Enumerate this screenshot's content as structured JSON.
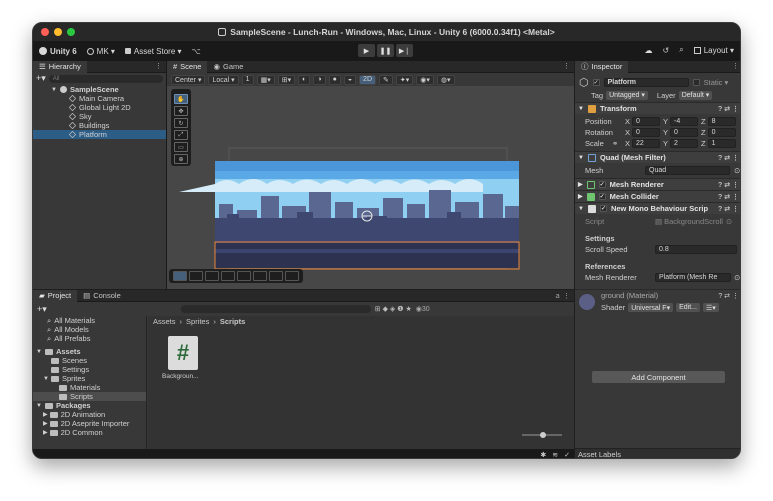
{
  "titlebar": {
    "title": "SampleScene - Lunch-Run - Windows, Mac, Linux - Unity 6 (6000.0.34f1) <Metal>"
  },
  "toolbar": {
    "unity_label": "Unity 6",
    "account_label": "MK ▾",
    "asset_store_label": "Asset Store ▾",
    "layout_label": "Layout ▾"
  },
  "hierarchy": {
    "tab_label": "Hierarchy",
    "search_placeholder": "All",
    "items": [
      {
        "label": "SampleScene"
      },
      {
        "label": "Main Camera"
      },
      {
        "label": "Global Light 2D"
      },
      {
        "label": "Sky"
      },
      {
        "label": "Buildings"
      },
      {
        "label": "Platform"
      }
    ]
  },
  "scene": {
    "tabs": [
      {
        "label": "Scene"
      },
      {
        "label": "Game"
      }
    ],
    "pivot_label": "Center ▾",
    "space_label": "Local ▾",
    "grid_value": "1",
    "mode_2d_label": "2D"
  },
  "inspector": {
    "tab_label": "Inspector",
    "object_name": "Platform",
    "static_label": "Static ▾",
    "tag_label": "Tag",
    "tag_value": "Untagged ▾",
    "layer_label": "Layer",
    "layer_value": "Default ▾",
    "transform": {
      "title": "Transform",
      "position_label": "Position",
      "position": [
        "0",
        "-4",
        "8"
      ],
      "rotation_label": "Rotation",
      "rotation": [
        "0",
        "0",
        "0"
      ],
      "scale_label": "Scale",
      "scale": [
        "22",
        "2",
        "1"
      ],
      "axes": [
        "X",
        "Y",
        "Z"
      ]
    },
    "mesh_filter": {
      "title": "Quad (Mesh Filter)",
      "mesh_label": "Mesh",
      "mesh_value": "Quad"
    },
    "mesh_renderer": {
      "title": "Mesh Renderer"
    },
    "mesh_collider": {
      "title": "Mesh Collider"
    },
    "mono": {
      "title": "New Mono Behaviour Scrip",
      "script_label": "Script",
      "script_value": "BackgroundScroll",
      "settings_heading": "Settings",
      "scroll_speed_label": "Scroll Speed",
      "scroll_speed_value": "0.8",
      "references_heading": "References",
      "mesh_renderer_label": "Mesh Renderer",
      "mesh_renderer_value": "Platform (Mesh Re"
    },
    "material": {
      "name": "ground (Material)",
      "shader_label": "Shader",
      "shader_value": "Universal F▾",
      "edit_label": "Edit..."
    },
    "add_component_label": "Add Component",
    "asset_labels": "Asset Labels"
  },
  "project": {
    "tabs": [
      {
        "label": "Project"
      },
      {
        "label": "Console"
      }
    ],
    "search_count": "30",
    "left_items": [
      {
        "label": "All Materials",
        "kind": "search"
      },
      {
        "label": "All Models",
        "kind": "search"
      },
      {
        "label": "All Prefabs",
        "kind": "search"
      },
      {
        "label": "Assets",
        "kind": "root"
      },
      {
        "label": "Scenes",
        "kind": "folder"
      },
      {
        "label": "Settings",
        "kind": "folder"
      },
      {
        "label": "Sprites",
        "kind": "folder"
      },
      {
        "label": "Materials",
        "kind": "sub"
      },
      {
        "label": "Scripts",
        "kind": "sub"
      },
      {
        "label": "Packages",
        "kind": "root"
      },
      {
        "label": "2D Animation",
        "kind": "folder"
      },
      {
        "label": "2D Aseprite Importer",
        "kind": "folder"
      },
      {
        "label": "2D Common",
        "kind": "folder"
      }
    ],
    "breadcrumb": [
      "Assets",
      "Sprites",
      "Scripts"
    ],
    "file_label": "Backgroun..."
  },
  "colors": {
    "accent_blue": "#2c5d87",
    "sky_top": "#5aa9e6",
    "ground": "#2c3250"
  }
}
